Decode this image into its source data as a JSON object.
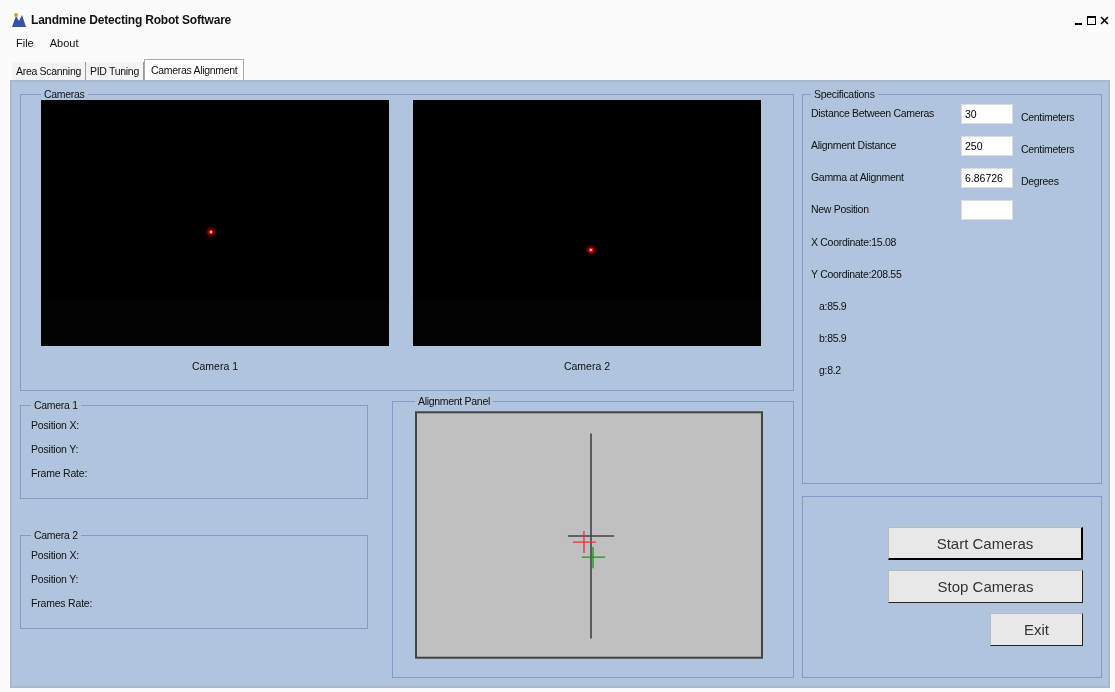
{
  "window": {
    "title": "Landmine Detecting Robot Software"
  },
  "menu": [
    "File",
    "About"
  ],
  "tabs": [
    {
      "label": "Area Scanning",
      "selected": false
    },
    {
      "label": "PID Tuning",
      "selected": false
    },
    {
      "label": "Cameras Alignment",
      "selected": true
    }
  ],
  "cameras": {
    "title": "Cameras",
    "feeds": [
      {
        "label": "Camera 1"
      },
      {
        "label": "Camera 2"
      }
    ]
  },
  "camera_info": [
    {
      "title": "Camera 1",
      "lines": [
        "Position X:",
        "Position Y:",
        "Frame Rate:"
      ]
    },
    {
      "title": "Camera 2",
      "lines": [
        "Position X:",
        "Position Y:",
        "Frames Rate:"
      ]
    }
  ],
  "alignment_panel": {
    "title": "Alignment Panel"
  },
  "specifications": {
    "title": "Specifications",
    "fields": [
      {
        "label": "Distance Between Cameras",
        "value": "30",
        "unit": "Centimeters"
      },
      {
        "label": "Alignment Distance",
        "value": "250",
        "unit": "Centimeters"
      },
      {
        "label": "Gamma at Alignment",
        "value": "6.86726",
        "unit": "Degrees"
      },
      {
        "label": "New Position"
      }
    ],
    "readouts": [
      {
        "text": "X Coordinate:15.08",
        "kind": "coordinate"
      },
      {
        "text": "Y Coordinate:208.55",
        "kind": "coordinate"
      },
      {
        "text": "a:85.9",
        "kind": "angle"
      },
      {
        "text": "b:85.9",
        "kind": "angle"
      },
      {
        "text": "g:8.2",
        "kind": "angle"
      }
    ]
  },
  "buttons": [
    {
      "label": "Start Cameras",
      "default": true,
      "kind": "wide"
    },
    {
      "label": "Stop Cameras",
      "default": false,
      "kind": "wide"
    },
    {
      "label": "Exit",
      "default": false,
      "kind": "narrow"
    }
  ]
}
